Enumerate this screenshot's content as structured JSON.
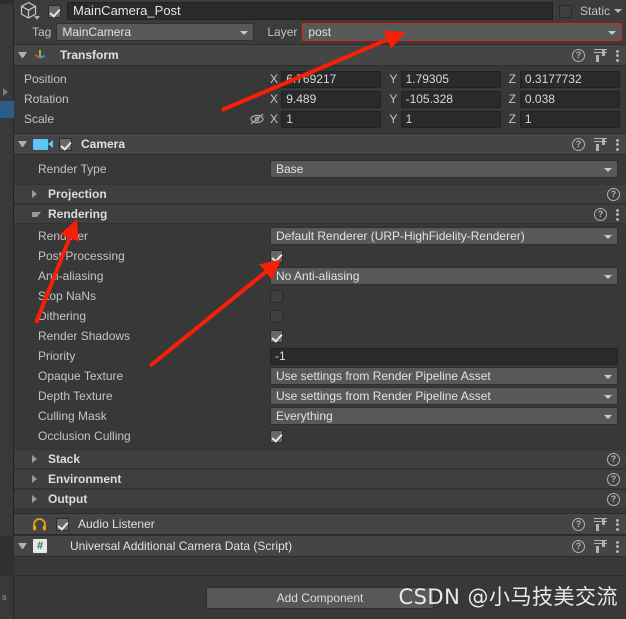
{
  "window": {
    "app": "Unity Inspector"
  },
  "header": {
    "gameobject_icon": "gameobject-cube-icon",
    "enabled_checkbox": true,
    "name": "MainCamera_Post",
    "static_label": "Static",
    "static_checked": false,
    "tag_label": "Tag",
    "tag_value": "MainCamera",
    "layer_label": "Layer",
    "layer_value": "post"
  },
  "transform": {
    "title": "Transform",
    "rows": [
      {
        "label": "Position",
        "x": "6.769217",
        "y": "1.79305",
        "z": "0.3177732"
      },
      {
        "label": "Rotation",
        "x": "9.489",
        "y": "-105.328",
        "z": "0.038"
      },
      {
        "label": "Scale",
        "x": "1",
        "y": "1",
        "z": "1"
      }
    ],
    "axis_x": "X",
    "axis_y": "Y",
    "axis_z": "Z"
  },
  "camera": {
    "title": "Camera",
    "enabled_checkbox": true,
    "render_type_label": "Render Type",
    "render_type_value": "Base",
    "projection_label": "Projection",
    "rendering_label": "Rendering",
    "rendering": [
      {
        "label": "Renderer",
        "type": "dropdown",
        "value": "Default Renderer (URP-HighFidelity-Renderer)"
      },
      {
        "label": "Post Processing",
        "type": "checkbox",
        "value": true
      },
      {
        "label": "Anti-aliasing",
        "type": "dropdown",
        "value": "No Anti-aliasing"
      },
      {
        "label": "Stop NaNs",
        "type": "checkbox",
        "value": false
      },
      {
        "label": "Dithering",
        "type": "checkbox",
        "value": false
      },
      {
        "label": "Render Shadows",
        "type": "checkbox",
        "value": true
      },
      {
        "label": "Priority",
        "type": "text",
        "value": "-1"
      },
      {
        "label": "Opaque Texture",
        "type": "dropdown",
        "value": "Use settings from Render Pipeline Asset"
      },
      {
        "label": "Depth Texture",
        "type": "dropdown",
        "value": "Use settings from Render Pipeline Asset"
      },
      {
        "label": "Culling Mask",
        "type": "dropdown",
        "value": "Everything"
      },
      {
        "label": "Occlusion Culling",
        "type": "checkbox",
        "value": true
      }
    ],
    "stack_label": "Stack",
    "environment_label": "Environment",
    "output_label": "Output"
  },
  "audio_listener": {
    "title": "Audio Listener",
    "enabled_checkbox": true,
    "icon": "headphones-icon"
  },
  "script_component": {
    "title": "Universal Additional Camera Data (Script)",
    "icon": "csharp-script-icon",
    "icon_glyph": "#"
  },
  "footer": {
    "add_component_label": "Add Component",
    "watermark": "CSDN @小马技美交流"
  },
  "icons": {
    "help": "?",
    "preset": "preset-settings-icon",
    "kebab": "more-options-icon"
  },
  "colors": {
    "panel_bg": "#383838",
    "header_bg": "#454545",
    "field_bg": "#2a2a2a",
    "dropdown_bg": "#585858",
    "accent_blue": "#5ec6f5",
    "annotation_red": "#f81f08",
    "selection_blue": "#2c5d87"
  }
}
